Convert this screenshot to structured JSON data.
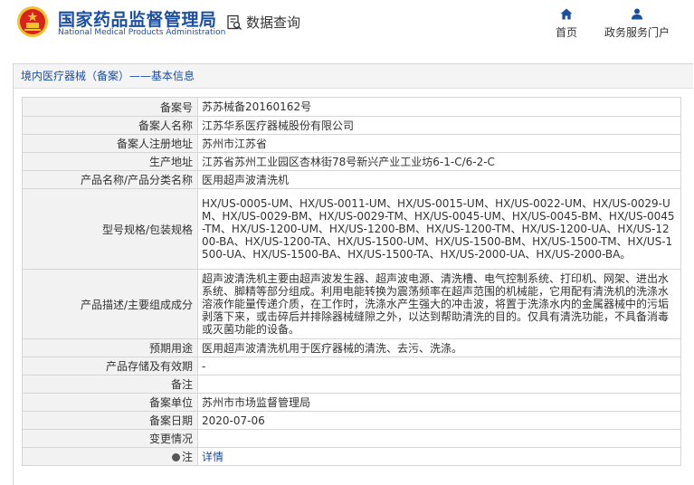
{
  "header": {
    "site_name_cn": "国家药品监督管理局",
    "site_name_en": "National Medical Products Administration",
    "query_label": "数据查询",
    "nav": [
      {
        "label": "首页",
        "icon": "home-icon"
      },
      {
        "label": "政务服务门户",
        "icon": "user-icon"
      }
    ]
  },
  "breadcrumb": {
    "category": "境内医疗器械（备案）",
    "separator": "——",
    "page": "基本信息"
  },
  "rows": [
    {
      "label": "备案号",
      "value": "苏苏械备20160162号"
    },
    {
      "label": "备案人名称",
      "value": "江苏华系医疗器械股份有限公司"
    },
    {
      "label": "备案人注册地址",
      "value": "苏州市江苏省"
    },
    {
      "label": "生产地址",
      "value": "江苏省苏州工业园区杏林街78号新兴产业工业坊6-1-C/6-2-C"
    },
    {
      "label": "产品名称/产品分类名称",
      "value": "医用超声波清洗机"
    },
    {
      "label": "型号规格/包装规格",
      "value": "HX/US-0005-UM、HX/US-0011-UM、HX/US-0015-UM、HX/US-0022-UM、HX/US-0029-UM、HX/US-0029-BM、HX/US-0029-TM、HX/US-0045-UM、HX/US-0045-BM、HX/US-0045-TM、HX/US-1200-UM、HX/US-1200-BM、HX/US-1200-TM、HX/US-1200-UA、HX/US-1200-BA、HX/US-1200-TA、HX/US-1500-UM、HX/US-1500-BM、HX/US-1500-TM、HX/US-1500-UA、HX/US-1500-BA、HX/US-1500-TA、HX/US-2000-UA、HX/US-2000-BA。"
    },
    {
      "label": "产品描述/主要组成成分",
      "value": "超声波清洗机主要由超声波发生器、超声波电源、清洗槽、电气控制系统、打印机、网架、进出水系统、脚精等部分组成。利用电能转换为震荡频率在超声范围的机械能，它用配有清洗机的洗涤水溶液作能量传递介质，在工作时，洗涤水产生强大的冲击波，将置于洗涤水内的金属器械中的污垢剥落下来，或击碎后并排除器械缝隙之外，以达到帮助清洗的目的。仅具有清洗功能，不具备消毒或灭菌功能的设备。"
    },
    {
      "label": "预期用途",
      "value": "医用超声波清洗机用于医疗器械的清洗、去污、洗涤。"
    },
    {
      "label": "产品存储及有效期",
      "value": "-"
    },
    {
      "label": "备注",
      "value": ""
    },
    {
      "label": "备案单位",
      "value": "苏州市市场监督管理局"
    },
    {
      "label": "备案日期",
      "value": "2020-07-06"
    },
    {
      "label": "变更情况",
      "value": ""
    }
  ],
  "note_row": {
    "label": "注",
    "link": "详情"
  },
  "colors": {
    "brand_blue": "#1d4fa0",
    "logo_red": "#d8231c",
    "logo_gold": "#f2c230"
  }
}
